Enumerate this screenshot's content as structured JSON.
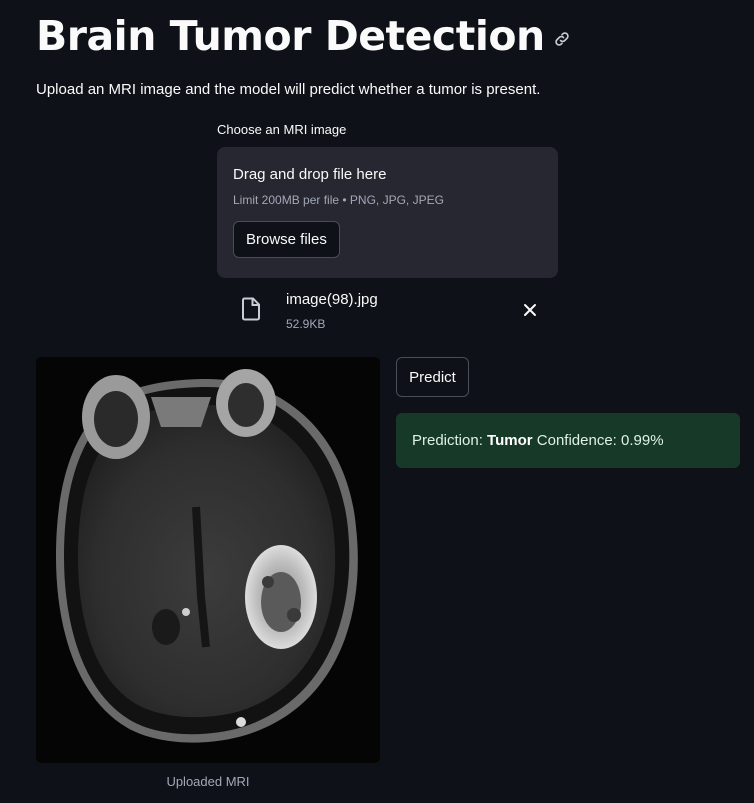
{
  "header": {
    "title": "Brain Tumor Detection",
    "anchor_icon": "link-icon"
  },
  "intro": {
    "text": "Upload an MRI image and the model will predict whether a tumor is present."
  },
  "uploader": {
    "label": "Choose an MRI image",
    "drop_title": "Drag and drop file here",
    "limit_text": "Limit 200MB per file • PNG, JPG, JPEG",
    "browse_label": "Browse files"
  },
  "uploaded_file": {
    "icon": "file-icon",
    "name": "image(98).jpg",
    "size": "52.9KB",
    "remove_icon": "close-icon"
  },
  "image": {
    "caption": "Uploaded MRI"
  },
  "actions": {
    "predict_label": "Predict"
  },
  "result": {
    "prefix": "Prediction: ",
    "label": "Tumor",
    "confidence_text": " Confidence: 0.99%",
    "color": "#173928"
  },
  "colors": {
    "background": "#0e1117",
    "surface": "#262730",
    "text": "#fafafa",
    "muted": "#a3a8b8"
  }
}
